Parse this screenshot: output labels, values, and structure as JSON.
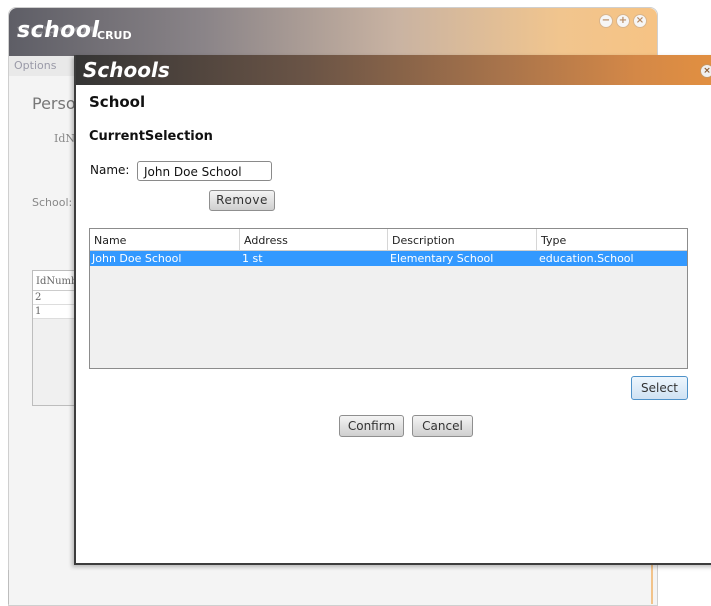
{
  "app": {
    "logo": "school",
    "logo_sub": "CRUD"
  },
  "window_controls": {
    "minimize": "−",
    "maximize": "+",
    "close": "×"
  },
  "background": {
    "menu": {
      "options": "Options"
    },
    "title": "Perso",
    "idnum_label": "IdNu",
    "school_label": "School:",
    "table": {
      "header": "IdNumb",
      "rows": [
        "2",
        "1"
      ]
    }
  },
  "dialog": {
    "title": "Schools",
    "close": "×",
    "heading": "School",
    "current_selection": "CurrentSelection",
    "name_label": "Name:",
    "name_value": "John Doe School",
    "remove_label": "Remove",
    "table": {
      "columns": [
        "Name",
        "Address",
        "Description",
        "Type"
      ],
      "rows": [
        {
          "name": "John Doe School",
          "address": "1 st",
          "description": "Elementary School",
          "type": "education.School"
        }
      ]
    },
    "select_label": "Select",
    "confirm_label": "Confirm",
    "cancel_label": "Cancel"
  },
  "colors": {
    "selection": "#3399ff",
    "title_orange": "#e6923f",
    "title_dark": "#353535"
  }
}
